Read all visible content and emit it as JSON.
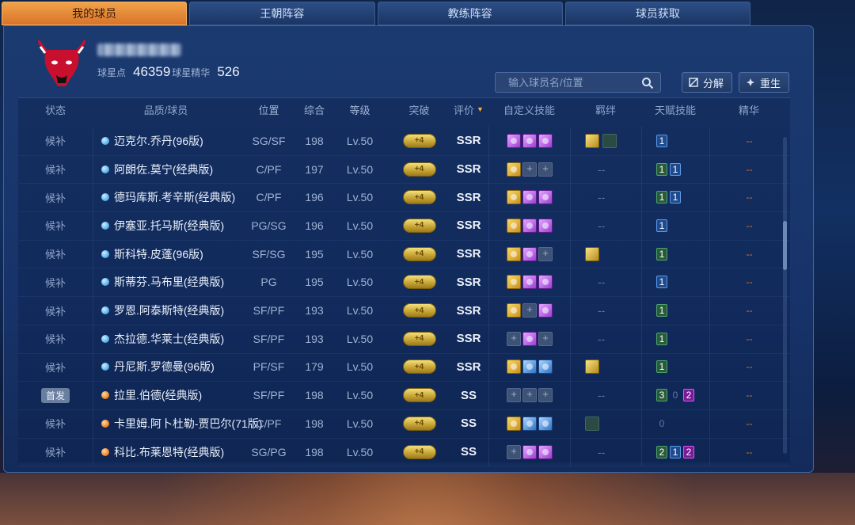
{
  "tabs": [
    {
      "label": "我的球员",
      "active": true
    },
    {
      "label": "王朝阵容",
      "active": false
    },
    {
      "label": "教练阵容",
      "active": false
    },
    {
      "label": "球员获取",
      "active": false
    }
  ],
  "header": {
    "star_points_label": "球星点",
    "star_points_value": "46359",
    "essence_label": "球星精华",
    "essence_value": "526"
  },
  "search": {
    "placeholder": "输入球员名/位置"
  },
  "buttons": {
    "decompose": "分解",
    "rebirth": "重生"
  },
  "columns": {
    "state": "状态",
    "name": "品质/球员",
    "pos": "位置",
    "ovr": "综合",
    "lvl": "等级",
    "break": "突破",
    "grade": "评价",
    "skill": "自定义技能",
    "bond": "羁绊",
    "talent": "天赋技能",
    "essence": "精华"
  },
  "rows": [
    {
      "state": "候补",
      "quality": "blue",
      "name": "迈克尔.乔丹(96版)",
      "pos": "SG/SF",
      "ovr": "198",
      "lvl": "Lv.50",
      "break": "+4",
      "grade": "SSR",
      "skills": [
        "purple",
        "purple",
        "purple"
      ],
      "bond": [
        "gold",
        "dim"
      ],
      "bond_text": "",
      "talents": [
        [
          "blue",
          "1"
        ]
      ],
      "essence": "--"
    },
    {
      "state": "候补",
      "quality": "blue",
      "name": "阿朗佐.莫宁(经典版)",
      "pos": "C/PF",
      "ovr": "197",
      "lvl": "Lv.50",
      "break": "+4",
      "grade": "SSR",
      "skills": [
        "gold",
        "empty",
        "empty"
      ],
      "bond": [],
      "bond_text": "--",
      "talents": [
        [
          "green",
          "1"
        ],
        [
          "blue",
          "1"
        ]
      ],
      "essence": "--"
    },
    {
      "state": "候补",
      "quality": "blue",
      "name": "德玛库斯.考辛斯(经典版)",
      "pos": "C/PF",
      "ovr": "196",
      "lvl": "Lv.50",
      "break": "+4",
      "grade": "SSR",
      "skills": [
        "gold",
        "purple",
        "purple"
      ],
      "bond": [],
      "bond_text": "--",
      "talents": [
        [
          "green",
          "1"
        ],
        [
          "blue",
          "1"
        ]
      ],
      "essence": "--"
    },
    {
      "state": "候补",
      "quality": "blue",
      "name": "伊塞亚.托马斯(经典版)",
      "pos": "PG/SG",
      "ovr": "196",
      "lvl": "Lv.50",
      "break": "+4",
      "grade": "SSR",
      "skills": [
        "gold",
        "purple",
        "purple"
      ],
      "bond": [],
      "bond_text": "--",
      "talents": [
        [
          "blue",
          "1"
        ]
      ],
      "essence": "--"
    },
    {
      "state": "候补",
      "quality": "blue",
      "name": "斯科特.皮蓬(96版)",
      "pos": "SF/SG",
      "ovr": "195",
      "lvl": "Lv.50",
      "break": "+4",
      "grade": "SSR",
      "skills": [
        "gold",
        "purple",
        "empty"
      ],
      "bond": [
        "gold"
      ],
      "bond_text": "",
      "talents": [
        [
          "green",
          "1"
        ]
      ],
      "essence": "--"
    },
    {
      "state": "候补",
      "quality": "blue",
      "name": "斯蒂芬.马布里(经典版)",
      "pos": "PG",
      "ovr": "195",
      "lvl": "Lv.50",
      "break": "+4",
      "grade": "SSR",
      "skills": [
        "gold",
        "purple",
        "purple"
      ],
      "bond": [],
      "bond_text": "--",
      "talents": [
        [
          "blue",
          "1"
        ]
      ],
      "essence": "--"
    },
    {
      "state": "候补",
      "quality": "blue",
      "name": "罗恩.阿泰斯特(经典版)",
      "pos": "SF/PF",
      "ovr": "193",
      "lvl": "Lv.50",
      "break": "+4",
      "grade": "SSR",
      "skills": [
        "gold",
        "empty",
        "purple"
      ],
      "bond": [],
      "bond_text": "--",
      "talents": [
        [
          "green",
          "1"
        ]
      ],
      "essence": "--"
    },
    {
      "state": "候补",
      "quality": "blue",
      "name": "杰拉德.华莱士(经典版)",
      "pos": "SF/PF",
      "ovr": "193",
      "lvl": "Lv.50",
      "break": "+4",
      "grade": "SSR",
      "skills": [
        "empty",
        "purple",
        "empty"
      ],
      "bond": [],
      "bond_text": "--",
      "talents": [
        [
          "green",
          "1"
        ]
      ],
      "essence": "--"
    },
    {
      "state": "候补",
      "quality": "blue",
      "name": "丹尼斯.罗德曼(96版)",
      "pos": "PF/SF",
      "ovr": "179",
      "lvl": "Lv.50",
      "break": "+4",
      "grade": "SSR",
      "skills": [
        "gold",
        "blue",
        "blue"
      ],
      "bond": [
        "gold"
      ],
      "bond_text": "",
      "talents": [
        [
          "green",
          "1"
        ]
      ],
      "essence": "--"
    },
    {
      "state": "首发",
      "quality": "orange",
      "name": "拉里.伯德(经典版)",
      "pos": "SF/PF",
      "ovr": "198",
      "lvl": "Lv.50",
      "break": "+4",
      "grade": "SS",
      "skills": [
        "empty",
        "empty",
        "empty"
      ],
      "bond": [],
      "bond_text": "--",
      "talents": [
        [
          "green",
          "3"
        ],
        [
          "gray",
          "0"
        ],
        [
          "purple",
          "2"
        ]
      ],
      "essence": "--"
    },
    {
      "state": "候补",
      "quality": "orange",
      "name": "卡里姆.阿卜杜勒-贾巴尔(71版)",
      "pos": "C/PF",
      "ovr": "198",
      "lvl": "Lv.50",
      "break": "+4",
      "grade": "SS",
      "skills": [
        "gold",
        "blue",
        "blue"
      ],
      "bond": [
        "dim"
      ],
      "bond_text": "",
      "talents": [
        [
          "gray",
          "0"
        ]
      ],
      "essence": "--"
    },
    {
      "state": "候补",
      "quality": "orange",
      "name": "科比.布莱恩特(经典版)",
      "pos": "SG/PG",
      "ovr": "198",
      "lvl": "Lv.50",
      "break": "+4",
      "grade": "SS",
      "skills": [
        "empty",
        "purple",
        "purple"
      ],
      "bond": [],
      "bond_text": "--",
      "talents": [
        [
          "green",
          "2"
        ],
        [
          "blue",
          "1"
        ],
        [
          "purple",
          "2"
        ]
      ],
      "essence": "--"
    }
  ]
}
